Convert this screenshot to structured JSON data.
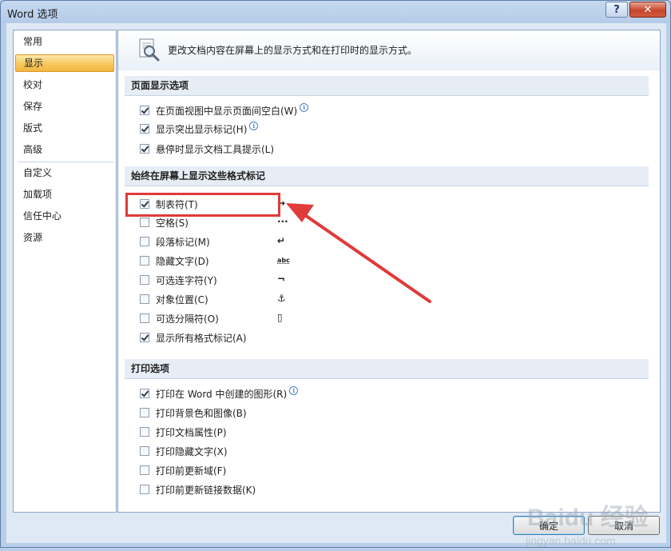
{
  "window": {
    "title": "Word 选项",
    "help_label": "?",
    "close_label": "✕"
  },
  "nav": {
    "items": [
      {
        "label": "常用"
      },
      {
        "label": "显示",
        "selected": true
      },
      {
        "label": "校对"
      },
      {
        "label": "保存"
      },
      {
        "label": "版式"
      },
      {
        "label": "高级"
      },
      {
        "label": "自定义"
      },
      {
        "label": "加载项"
      },
      {
        "label": "信任中心"
      },
      {
        "label": "资源"
      }
    ]
  },
  "banner": {
    "text": "更改文档内容在屏幕上的显示方式和在打印时的显示方式。",
    "icon": "magnifier-document-icon"
  },
  "sections": {
    "page_display": {
      "header": "页面显示选项",
      "options": [
        {
          "label": "在页面视图中显示页面间空白(W)",
          "checked": true,
          "info": true
        },
        {
          "label": "显示突出显示标记(H)",
          "checked": true,
          "info": true
        },
        {
          "label": "悬停时显示文档工具提示(L)",
          "checked": true,
          "info": false
        }
      ]
    },
    "format_marks": {
      "header": "始终在屏幕上显示这些格式标记",
      "options": [
        {
          "label": "制表符(T)",
          "checked": true,
          "mark": "→"
        },
        {
          "label": "空格(S)",
          "checked": false,
          "mark": "···"
        },
        {
          "label": "段落标记(M)",
          "checked": false,
          "mark": "↵"
        },
        {
          "label": "隐藏文字(D)",
          "checked": false,
          "mark": "abc"
        },
        {
          "label": "可选连字符(Y)",
          "checked": false,
          "mark": "¬"
        },
        {
          "label": "对象位置(C)",
          "checked": false,
          "mark": "⚓"
        },
        {
          "label": "可选分隔符(O)",
          "checked": false,
          "mark": "▯"
        },
        {
          "label": "显示所有格式标记(A)",
          "checked": true,
          "mark": ""
        }
      ]
    },
    "print": {
      "header": "打印选项",
      "options": [
        {
          "label": "打印在 Word 中创建的图形(R)",
          "checked": true,
          "info": true
        },
        {
          "label": "打印背景色和图像(B)",
          "checked": false
        },
        {
          "label": "打印文档属性(P)",
          "checked": false
        },
        {
          "label": "打印隐藏文字(X)",
          "checked": false
        },
        {
          "label": "打印前更新域(F)",
          "checked": false
        },
        {
          "label": "打印前更新链接数据(K)",
          "checked": false
        }
      ]
    }
  },
  "buttons": {
    "ok_label": "确定",
    "cancel_label": "取消"
  },
  "watermark": {
    "text": "Baidu 经验",
    "subtext": "jingyan.baidu.com"
  },
  "colors": {
    "highlight": "#e03a3a",
    "selected_nav": "#f6c65a"
  }
}
